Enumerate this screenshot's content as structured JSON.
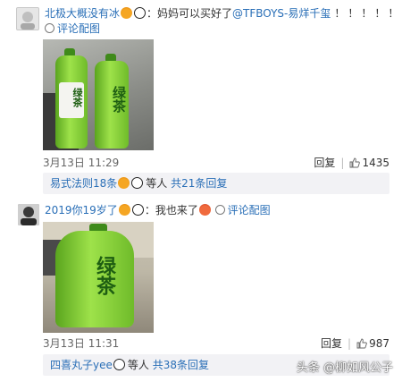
{
  "comments": [
    {
      "username": "北极大概没有冰",
      "text": "：妈妈可以买好了",
      "mention": "@TFBOYS-易烊千玺",
      "exclaim": "！！！！！",
      "sub_label": "评论配图",
      "photo_text": "绿茶",
      "date": "3月13日 11:29",
      "reply_label": "回复",
      "likes": "1435",
      "replies_preview": {
        "name": "易式法则18条",
        "suffix": "等人",
        "total": "共21条回复"
      }
    },
    {
      "username": "2019你19岁了",
      "text": "：我也来了",
      "sub_label": "评论配图",
      "photo_text": "绿茶",
      "date": "3月13日 11:31",
      "reply_label": "回复",
      "likes": "987",
      "replies_preview": {
        "name": "四喜丸子yee",
        "suffix": "等人",
        "total": "共38条回复"
      }
    }
  ],
  "watermark": "头条 @柳如风公子",
  "colors": {
    "link": "#2a6fb7",
    "reply_bg": "#f2f2f5",
    "bottle_green": "#8fd43c"
  }
}
